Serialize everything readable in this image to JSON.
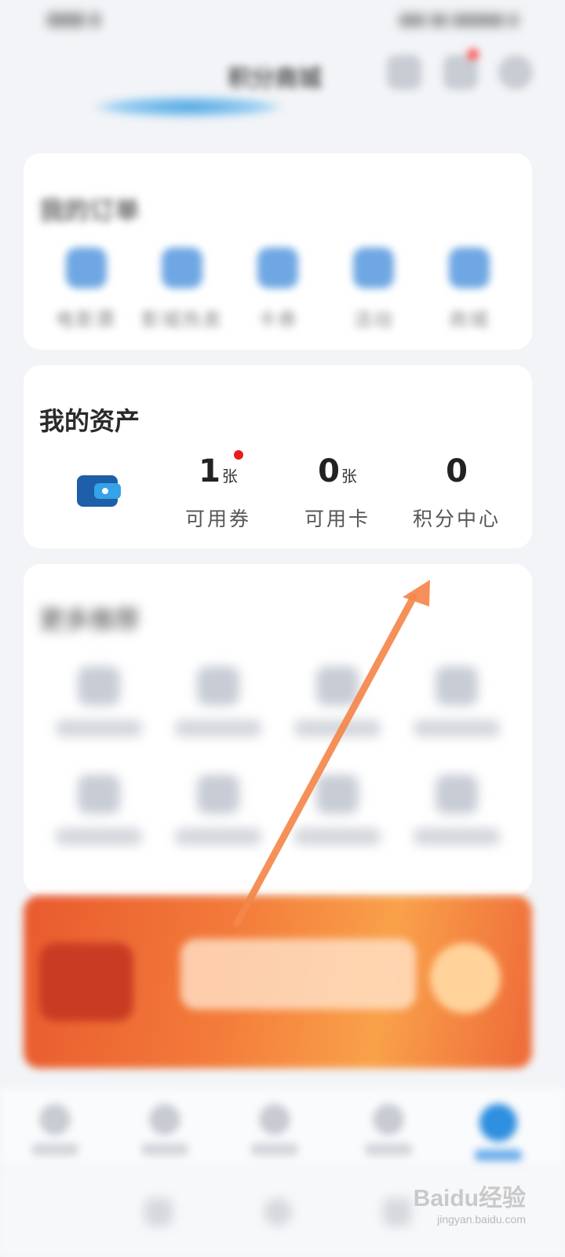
{
  "header": {
    "user_name": "积分商城"
  },
  "orders_card": {
    "title": "我的订单",
    "items": [
      {
        "label": "电影票",
        "icon": "ticket-icon"
      },
      {
        "label": "影城热卖",
        "icon": "popcorn-icon"
      },
      {
        "label": "卡券",
        "icon": "card-icon"
      },
      {
        "label": "活动",
        "icon": "activity-icon"
      },
      {
        "label": "商城",
        "icon": "shop-icon"
      }
    ]
  },
  "assets_card": {
    "title": "我的资产",
    "icon": "wallet-icon",
    "coupons": {
      "value": "1",
      "unit": "张",
      "label": "可用券"
    },
    "cards": {
      "value": "0",
      "unit": "张",
      "label": "可用卡"
    },
    "points": {
      "value": "0",
      "label": "积分中心"
    }
  },
  "more_card": {
    "title": "更多推荐"
  },
  "watermark": {
    "brand": "Baidu经验",
    "url": "jingyan.baidu.com"
  },
  "colors": {
    "accent": "#2f8fe0",
    "badge_red": "#e81c1c",
    "arrow": "#f5874a",
    "wallet": "#1d5fa8"
  }
}
